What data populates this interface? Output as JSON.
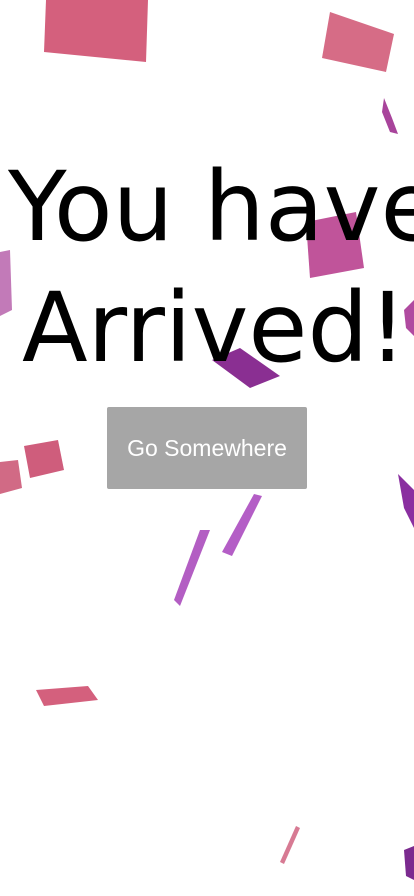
{
  "headline": {
    "line1": "You have",
    "line2": "Arrived!"
  },
  "button": {
    "label": "Go Somewhere"
  },
  "colors": {
    "background": "#ffffff",
    "text": "#000000",
    "button_background": "#a6a6a6",
    "button_text": "#ffffff",
    "confetti_pink": "#d4607d",
    "confetti_magenta": "#a8449b",
    "confetti_purple": "#7b2a8f"
  }
}
